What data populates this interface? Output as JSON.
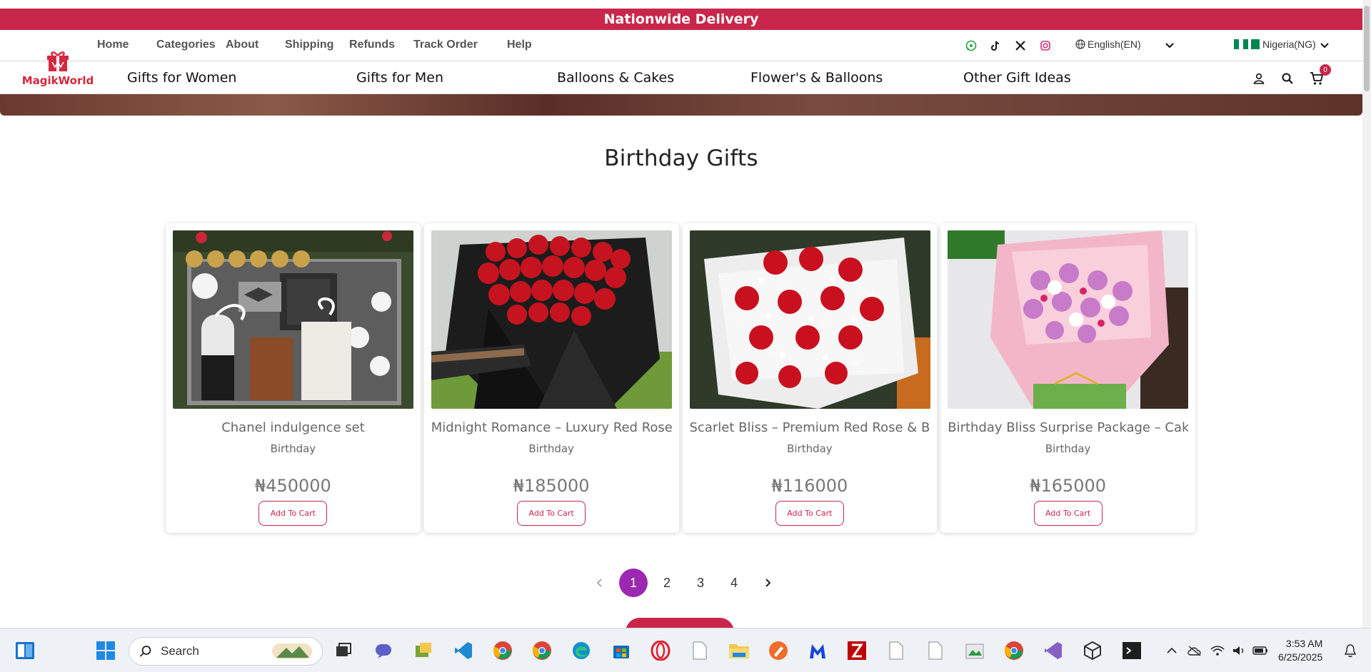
{
  "announcement": "Nationwide Delivery",
  "brand": {
    "name": "MagikWorld"
  },
  "topnav": [
    "Home",
    "Categories",
    "About",
    "Shipping",
    "Refunds",
    "Track Order",
    "Help"
  ],
  "language": "English(EN)",
  "country": "Nigeria(NG)",
  "mainnav": [
    "Gifts for Women",
    "Gifts for Men",
    "Balloons & Cakes",
    "Flower's & Balloons",
    "Other Gift Ideas"
  ],
  "cart_count": "0",
  "section_title": "Birthday Gifts",
  "products": [
    {
      "title": "Chanel indulgence set",
      "category": "Birthday",
      "price": "₦450000",
      "button": "Add To Cart"
    },
    {
      "title": "Midnight Romance – Luxury Red Rose...",
      "category": "Birthday",
      "price": "₦185000",
      "button": "Add To Cart"
    },
    {
      "title": "Scarlet Bliss – Premium Red Rose & B...",
      "category": "Birthday",
      "price": "₦116000",
      "button": "Add To Cart"
    },
    {
      "title": "Birthday Bliss Surprise Package – Cak...",
      "category": "Birthday",
      "price": "₦165000",
      "button": "Add To Cart"
    }
  ],
  "pagination": {
    "pages": [
      "1",
      "2",
      "3",
      "4"
    ],
    "active": "1"
  },
  "taskbar": {
    "search_placeholder": "Search",
    "time": "3:53 AM",
    "date": "6/25/2025"
  },
  "colors": {
    "accent": "#c8264a",
    "pager_active": "#9c27b0"
  }
}
